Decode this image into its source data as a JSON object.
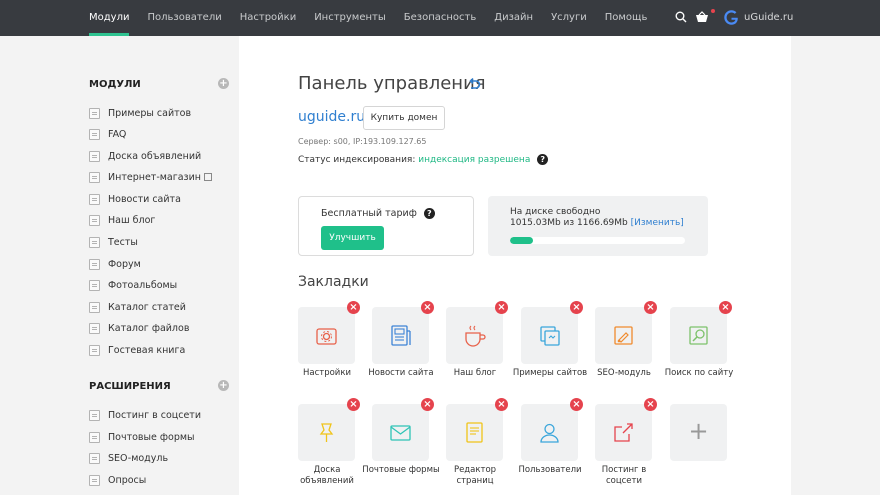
{
  "nav": {
    "items": [
      "Модули",
      "Пользователи",
      "Настройки",
      "Инструменты",
      "Безопасность",
      "Дизайн",
      "Услуги",
      "Помощь"
    ],
    "active": "Модули",
    "site_name": "uGuide.ru"
  },
  "sidebar": {
    "modules_title": "МОДУЛИ",
    "modules": [
      "Примеры сайтов",
      "FAQ",
      "Доска объявлений",
      "Интернет-магазин",
      "Новости сайта",
      "Наш блог",
      "Тесты",
      "Форум",
      "Фотоальбомы",
      "Каталог статей",
      "Каталог файлов",
      "Гостевая книга"
    ],
    "extensions_title": "РАСШИРЕНИЯ",
    "extensions": [
      "Постинг в соцсети",
      "Почтовые формы",
      "SEO-модуль",
      "Опросы"
    ]
  },
  "main": {
    "title": "Панель управления",
    "domain": "uguide.ru",
    "buy_domain": "Купить домен",
    "server": "Сервер: s00, IP:193.109.127.65",
    "status_label": "Статус индексирования:",
    "status_value": "индексация разрешена",
    "tariff_label": "Бесплатный тариф",
    "upgrade": "Улучшить",
    "disk_label": "На диске свободно",
    "disk_info": "1015.03Mb из 1166.69Mb",
    "disk_change": "[Изменить]",
    "disk_used_fraction": 0.13,
    "bookmarks_title": "Закладки"
  },
  "bookmarks": [
    {
      "label": "Настройки",
      "icon": "settings-icon",
      "color": "#e8614a"
    },
    {
      "label": "Новости сайта",
      "icon": "news-icon",
      "color": "#3d84d6"
    },
    {
      "label": "Наш блог",
      "icon": "cup-icon",
      "color": "#e8614a"
    },
    {
      "label": "Примеры сайтов",
      "icon": "examples-icon",
      "color": "#3aa6db"
    },
    {
      "label": "SEO-модуль",
      "icon": "seo-icon",
      "color": "#f08b2e"
    },
    {
      "label": "Поиск по сайту",
      "icon": "search-site-icon",
      "color": "#7dc26b"
    },
    {
      "label": "Доска объявлений",
      "icon": "pin-icon",
      "color": "#f0c419"
    },
    {
      "label": "Почтовые формы",
      "icon": "mail-icon",
      "color": "#2ec4b6"
    },
    {
      "label": "Редактор страниц",
      "icon": "editor-icon",
      "color": "#f0c419"
    },
    {
      "label": "Пользователи",
      "icon": "user-icon",
      "color": "#3aa6db"
    },
    {
      "label": "Постинг в соцсети",
      "icon": "share-icon",
      "color": "#e5434d"
    }
  ],
  "add_tile": "+",
  "remove_glyph": "×",
  "add_glyph": "+",
  "question_glyph": "?",
  "colors": {
    "accent": "#1fc08a",
    "link": "#2f7fd0",
    "danger": "#e5434d",
    "topbar": "#383b40"
  }
}
